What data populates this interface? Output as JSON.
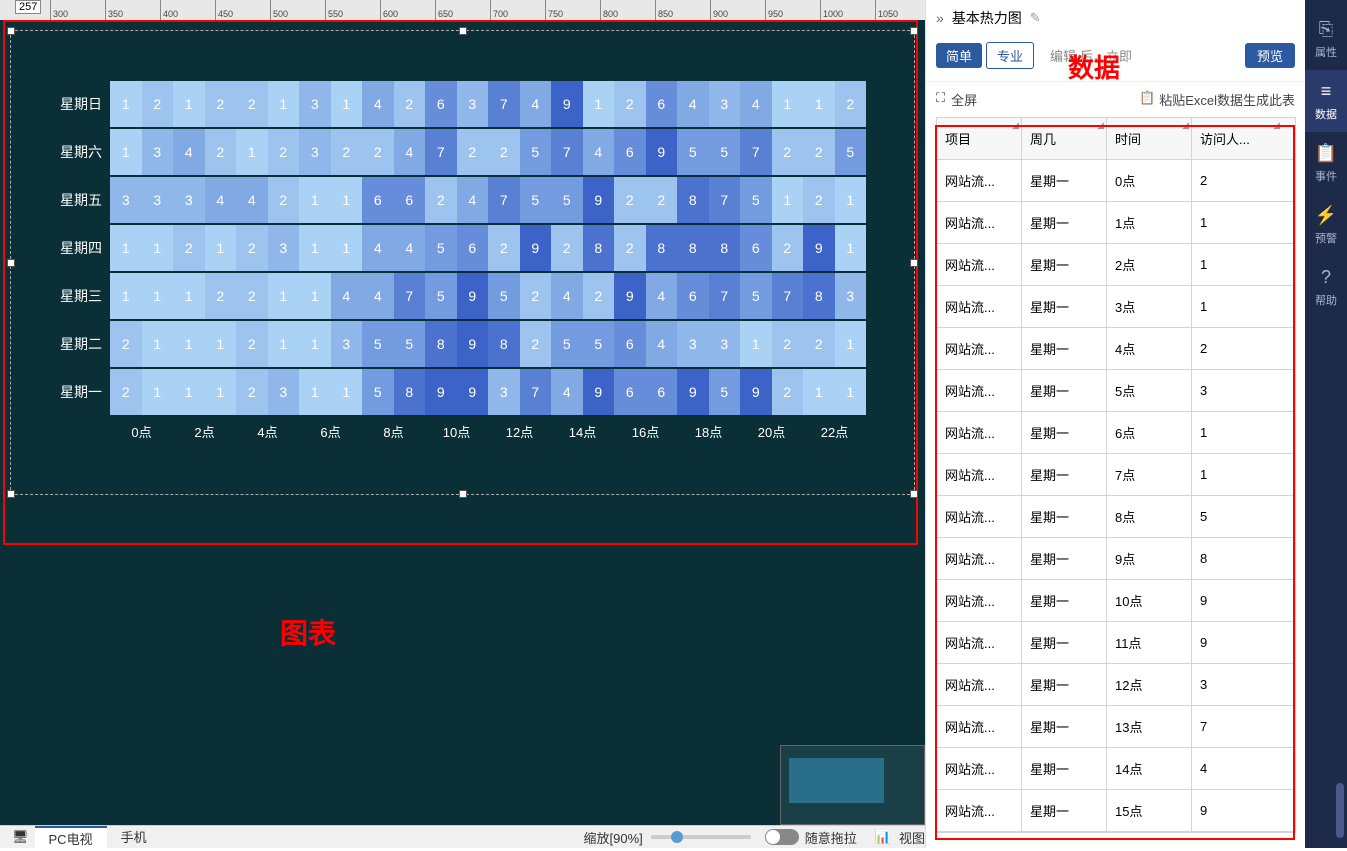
{
  "canvas": {
    "y_indicator": "257",
    "ruler_marks": [
      "300",
      "350",
      "400",
      "450",
      "500",
      "550",
      "600",
      "650",
      "700",
      "750",
      "800",
      "850",
      "900",
      "950",
      "1000",
      "1050"
    ]
  },
  "annotations": {
    "chart_label": "图表",
    "data_label": "数据"
  },
  "chart_data": {
    "type": "heatmap",
    "title": "",
    "y_labels": [
      "星期日",
      "星期六",
      "星期五",
      "星期四",
      "星期三",
      "星期二",
      "星期一"
    ],
    "x_labels": [
      "0点",
      "2点",
      "4点",
      "6点",
      "8点",
      "10点",
      "12点",
      "14点",
      "16点",
      "18点",
      "20点",
      "22点"
    ],
    "grid": [
      [
        1,
        2,
        1,
        2,
        2,
        1,
        3,
        1,
        4,
        2,
        6,
        3,
        7,
        4,
        9,
        1,
        2,
        6,
        4,
        3,
        4,
        1,
        1,
        2
      ],
      [
        1,
        3,
        4,
        2,
        1,
        2,
        3,
        2,
        2,
        4,
        7,
        2,
        2,
        5,
        7,
        4,
        6,
        9,
        5,
        5,
        7,
        2,
        2,
        5
      ],
      [
        3,
        3,
        3,
        4,
        4,
        2,
        1,
        1,
        6,
        6,
        2,
        4,
        7,
        5,
        5,
        9,
        2,
        2,
        8,
        7,
        5,
        1,
        2,
        1
      ],
      [
        1,
        1,
        2,
        1,
        2,
        3,
        1,
        1,
        4,
        4,
        5,
        6,
        2,
        9,
        2,
        8,
        2,
        8,
        8,
        8,
        6,
        2,
        9,
        1
      ],
      [
        1,
        1,
        1,
        2,
        2,
        1,
        1,
        4,
        4,
        7,
        5,
        9,
        5,
        2,
        4,
        2,
        9,
        4,
        6,
        7,
        5,
        7,
        8,
        3
      ],
      [
        2,
        1,
        1,
        1,
        2,
        1,
        1,
        3,
        5,
        5,
        8,
        9,
        8,
        2,
        5,
        5,
        6,
        4,
        3,
        3,
        1,
        2,
        2,
        1
      ],
      [
        2,
        1,
        1,
        1,
        2,
        3,
        1,
        1,
        5,
        8,
        9,
        9,
        3,
        7,
        4,
        9,
        6,
        6,
        9,
        5,
        9,
        2,
        1,
        1
      ]
    ]
  },
  "statusbar": {
    "device_pc": "PC电视",
    "device_mobile": "手机",
    "zoom_label": "缩放[90%]",
    "drag_label": "随意拖拉",
    "view_label": "视图"
  },
  "panel": {
    "title": "基本热力图",
    "tab_simple": "简单",
    "tab_pro": "专业",
    "edit_hint_prefix": "编辑",
    "edit_hint_suffix": "后，立即",
    "preview": "预览",
    "fullscreen": "全屏",
    "paste_excel": "粘贴Excel数据生成此表"
  },
  "table": {
    "headers": [
      "项目",
      "周几",
      "时间",
      "访问人..."
    ],
    "rows": [
      [
        "网站流...",
        "星期一",
        "0点",
        "2"
      ],
      [
        "网站流...",
        "星期一",
        "1点",
        "1"
      ],
      [
        "网站流...",
        "星期一",
        "2点",
        "1"
      ],
      [
        "网站流...",
        "星期一",
        "3点",
        "1"
      ],
      [
        "网站流...",
        "星期一",
        "4点",
        "2"
      ],
      [
        "网站流...",
        "星期一",
        "5点",
        "3"
      ],
      [
        "网站流...",
        "星期一",
        "6点",
        "1"
      ],
      [
        "网站流...",
        "星期一",
        "7点",
        "1"
      ],
      [
        "网站流...",
        "星期一",
        "8点",
        "5"
      ],
      [
        "网站流...",
        "星期一",
        "9点",
        "8"
      ],
      [
        "网站流...",
        "星期一",
        "10点",
        "9"
      ],
      [
        "网站流...",
        "星期一",
        "11点",
        "9"
      ],
      [
        "网站流...",
        "星期一",
        "12点",
        "3"
      ],
      [
        "网站流...",
        "星期一",
        "13点",
        "7"
      ],
      [
        "网站流...",
        "星期一",
        "14点",
        "4"
      ],
      [
        "网站流...",
        "星期一",
        "15点",
        "9"
      ]
    ]
  },
  "rail": {
    "items": [
      {
        "icon": "⎘",
        "label": "属性"
      },
      {
        "icon": "≡",
        "label": "数据"
      },
      {
        "icon": "📋",
        "label": "事件"
      },
      {
        "icon": "⚡",
        "label": "预警"
      },
      {
        "icon": "?",
        "label": "帮助"
      }
    ]
  }
}
